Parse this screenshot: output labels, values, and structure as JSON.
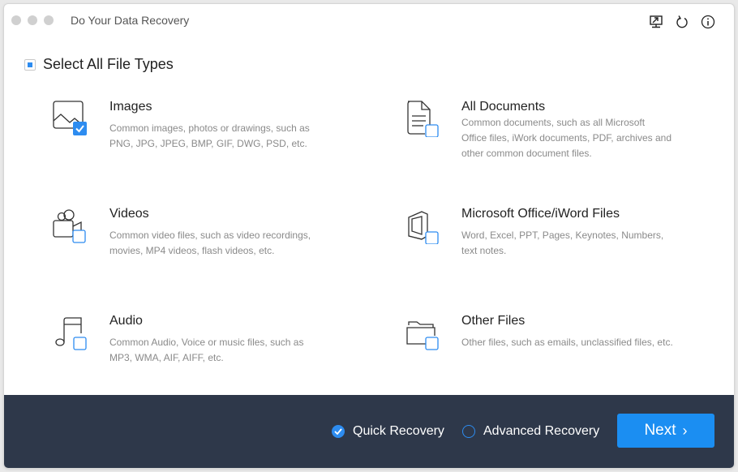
{
  "window": {
    "title": "Do Your Data Recovery",
    "toolbar_icons": [
      "screen-share-icon",
      "refresh-icon",
      "info-icon"
    ]
  },
  "select_all": {
    "label": "Select All File Types",
    "state": "partial"
  },
  "file_types": [
    {
      "name": "Images",
      "description": "Common images, photos or drawings, such as PNG, JPG, JPEG, BMP, GIF, DWG, PSD, etc.",
      "checked": true,
      "icon": "image-icon"
    },
    {
      "name": "All Documents",
      "description": "Common documents, such as all Microsoft Office files, iWork documents, PDF, archives and other common document files.",
      "checked": false,
      "icon": "document-icon"
    },
    {
      "name": "Videos",
      "description": "Common video files, such as video recordings, movies, MP4 videos, flash videos, etc.",
      "checked": false,
      "icon": "video-camera-icon"
    },
    {
      "name": "Microsoft Office/iWord Files",
      "description": "Word, Excel, PPT, Pages, Keynotes, Numbers, text notes.",
      "checked": false,
      "icon": "office-icon"
    },
    {
      "name": "Audio",
      "description": "Common Audio, Voice or music files, such as MP3, WMA, AIF, AIFF, etc.",
      "checked": false,
      "icon": "music-note-icon"
    },
    {
      "name": "Other Files",
      "description": "Other files, such as emails, unclassified files, etc.",
      "checked": false,
      "icon": "folder-icon"
    }
  ],
  "footer": {
    "modes": [
      {
        "label": "Quick Recovery",
        "selected": true
      },
      {
        "label": "Advanced Recovery",
        "selected": false
      }
    ],
    "next_label": "Next",
    "next_chevron": "›"
  },
  "colors": {
    "accent": "#2d8cf0",
    "footer_bg": "#2e384a",
    "button": "#1b8ef2"
  }
}
